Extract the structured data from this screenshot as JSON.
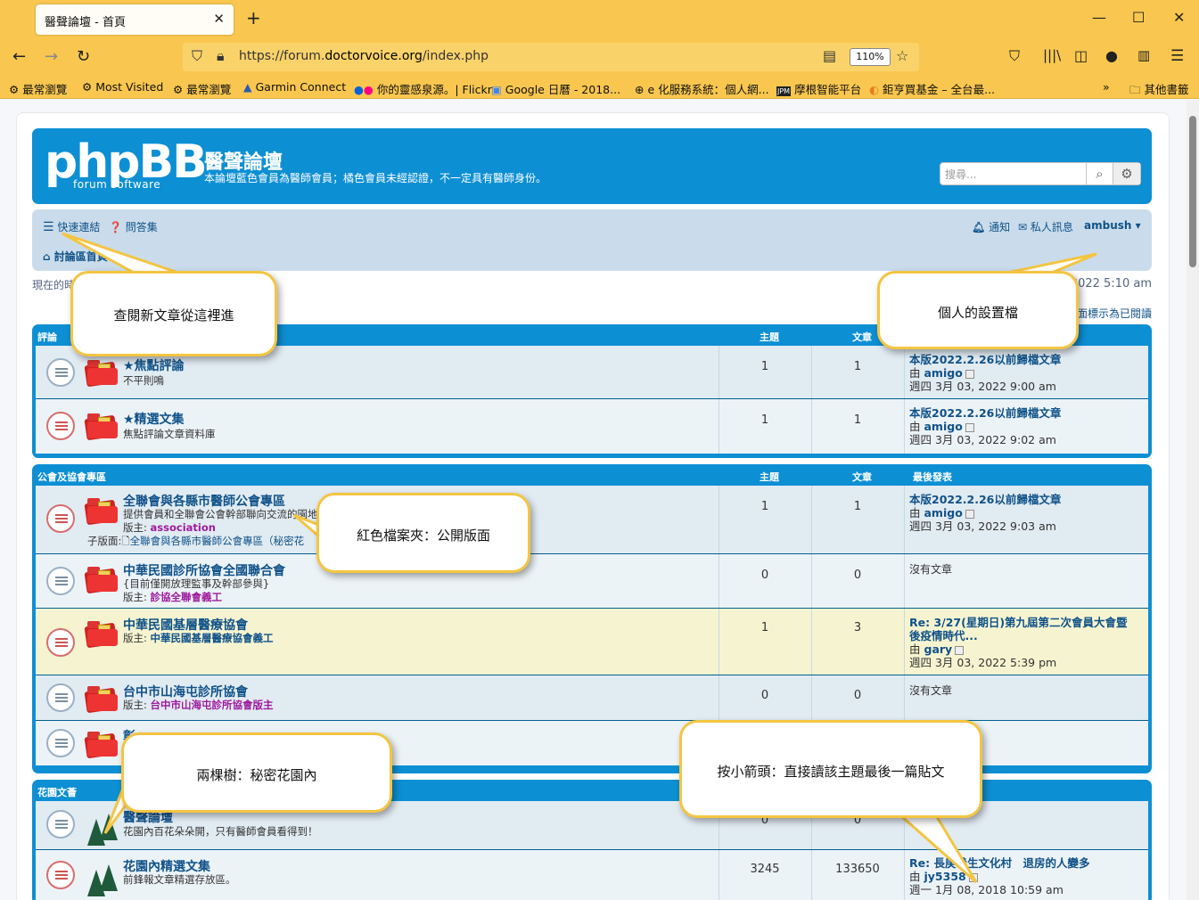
{
  "browser": {
    "tab_title": "醫聲論壇 - 首頁",
    "url_prefix": "https://forum.",
    "url_host": "doctorvoice.org",
    "url_path": "/index.php",
    "zoom": "110%",
    "bookmarks": [
      "最常瀏覽",
      "Most Visited",
      "最常瀏覽",
      "Garmin Connect",
      "你的靈感泉源。| Flickr",
      "Google 日曆 - 2018...",
      "e 化服務系統：個人網...",
      "摩根智能平台",
      "鉅亨買基金 – 全台最...",
      "其他書籤"
    ]
  },
  "site": {
    "logo_main": "phpBB",
    "logo_sub": "forum  software",
    "name": "醫聲論壇",
    "description": "本論壇藍色會員為醫師會員；橘色會員未經認證，不一定具有醫師身份。",
    "search_placeholder": "搜尋..."
  },
  "nav": {
    "quick_links": "快速連結",
    "faq": "問答集",
    "notifications": "通知",
    "pm": "私人訊息",
    "username": "ambush",
    "board_index": "討論區首頁",
    "time_left": "現在的時",
    "time_right": "2022 5:10 am",
    "mark_read": "面標示為已閱讀"
  },
  "categories": [
    {
      "name": "評論",
      "col_topics": "主題",
      "col_posts": "文章",
      "col_last": "",
      "forums": [
        {
          "title": "★焦點評論",
          "desc": "不平則鳴",
          "topics": "1",
          "posts": "1",
          "last_title": "本版2022.2.26以前歸檔文章",
          "last_by": "由",
          "last_user": "amigo",
          "last_time": "週四 3月 03, 2022 9:00 am"
        },
        {
          "title": "★精選文集",
          "desc": "焦點評論文章資料庫",
          "topics": "1",
          "posts": "1",
          "last_title": "本版2022.2.26以前歸檔文章",
          "last_by": "由",
          "last_user": "amigo",
          "last_time": "週四 3月 03, 2022 9:02 am"
        }
      ]
    },
    {
      "name": "公會及協會專區",
      "col_topics": "主題",
      "col_posts": "文章",
      "col_last": "最後發表",
      "forums": [
        {
          "title": "全聯會與各縣市醫師公會專區",
          "desc": "提供會員和全聯會公會幹部聯向交流的園地",
          "mod_label": "版主:",
          "mod": "association",
          "sub_label": "子版面:",
          "sub": "全聯會與各縣市醫師公會專區（秘密花",
          "topics": "1",
          "posts": "1",
          "last_title": "本版2022.2.26以前歸檔文章",
          "last_by": "由",
          "last_user": "amigo",
          "last_time": "週四 3月 03, 2022 9:03 am"
        },
        {
          "title": "中華民國診所協會全國聯合會",
          "desc": "{目前僅開放理監事及幹部參與}",
          "mod_label": "版主:",
          "mod": "診協全聯會義工",
          "topics": "0",
          "posts": "0",
          "no_posts": "沒有文章"
        },
        {
          "title": "中華民國基層醫療協會",
          "mod_label": "版主:",
          "mod": "中華民國基層醫療協會義工",
          "topics": "1",
          "posts": "3",
          "last_title": "Re: 3/27(星期日)第九屆第二次會員大會暨",
          "last_title2": "後疫情時代...",
          "last_by": "由",
          "last_user": "gary",
          "last_time": "週四 3月 03, 2022 5:39 pm"
        },
        {
          "title": "台中市山海屯診所協會",
          "mod_label": "版主:",
          "mod": "台中市山海屯診所協會版主",
          "topics": "0",
          "posts": "0",
          "no_posts": "沒有文章"
        },
        {
          "title": "彰"
        }
      ]
    },
    {
      "name": "花園文薈",
      "forums": [
        {
          "title": "醫聲論壇",
          "desc": "花園內百花朵朵開，只有醫師會員看得到！",
          "topics": "0",
          "posts": "0"
        },
        {
          "title": "花園內精選文集",
          "desc": "前鋒報文章精選存放區。",
          "topics": "3245",
          "posts": "133650",
          "last_title": "Re: 長庚養生文化村　退房的人變多",
          "last_by": "由",
          "last_user": "jy5358",
          "last_time": "週一 1月 08, 2018 10:59 am"
        }
      ]
    }
  ],
  "callouts": {
    "quick_links_tip": "查閱新文章從這裡進",
    "profile_tip": "個人的設置檔",
    "red_folder_tip": "紅色檔案夾：公開版面",
    "trees_tip": "兩棵樹：秘密花園內",
    "arrow_tip": "按小箭頭：直接讀該主題最後一篇貼文"
  }
}
